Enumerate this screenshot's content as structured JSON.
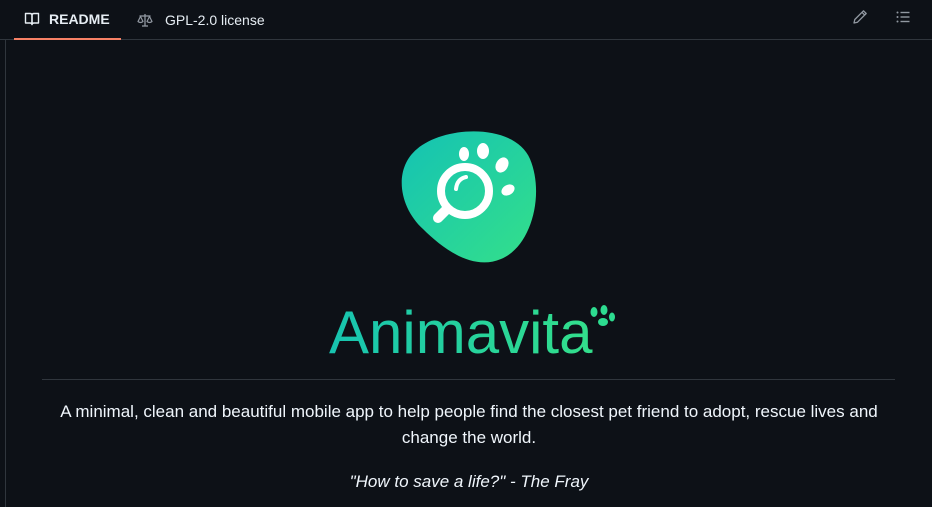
{
  "tabs": {
    "readme_label": "README",
    "license_label": "GPL-2.0 license"
  },
  "toolbar": {
    "edit_icon": "pencil-icon",
    "outline_icon": "list-unordered-icon"
  },
  "readme": {
    "logo_text": "Animavita",
    "description": "A minimal, clean and beautiful mobile app to help people find the closest pet friend to adopt, rescue lives and change the world.",
    "quote": "\"How to save a life?\" - The Fray"
  },
  "colors": {
    "background": "#0d1117",
    "border": "#30363d",
    "tab_underline": "#f78166",
    "brand_teal": "#1ec9a6",
    "brand_green": "#2ee08a"
  }
}
